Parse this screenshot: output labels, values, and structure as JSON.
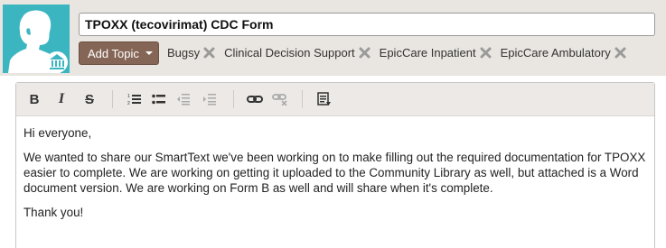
{
  "header": {
    "title_value": "TPOXX (tecovirimat) CDC Form",
    "add_topic_label": "Add Topic",
    "tags": [
      "Bugsy",
      "Clinical Decision Support",
      "EpicCare Inpatient",
      "EpicCare Ambulatory"
    ],
    "avatar_color": "#3bb6c1"
  },
  "toolbar": {
    "icons": [
      "bold-icon",
      "italic-icon",
      "strikethrough-icon",
      "numbered-list-icon",
      "bulleted-list-icon",
      "decrease-indent-icon",
      "increase-indent-icon",
      "link-icon",
      "unlink-icon",
      "insert-smarttext-icon"
    ],
    "bold_label": "B",
    "italic_label": "I",
    "strike_label": "S"
  },
  "content": {
    "greeting": "Hi everyone,",
    "body": "We wanted to share our SmartText we've been working on to make filling out the required documentation for TPOXX easier to complete. We are working on getting it uploaded to the Community Library as well, but attached is a Word document version. We are working on Form B as well and will share when it's complete.",
    "closing": "Thank you!"
  }
}
